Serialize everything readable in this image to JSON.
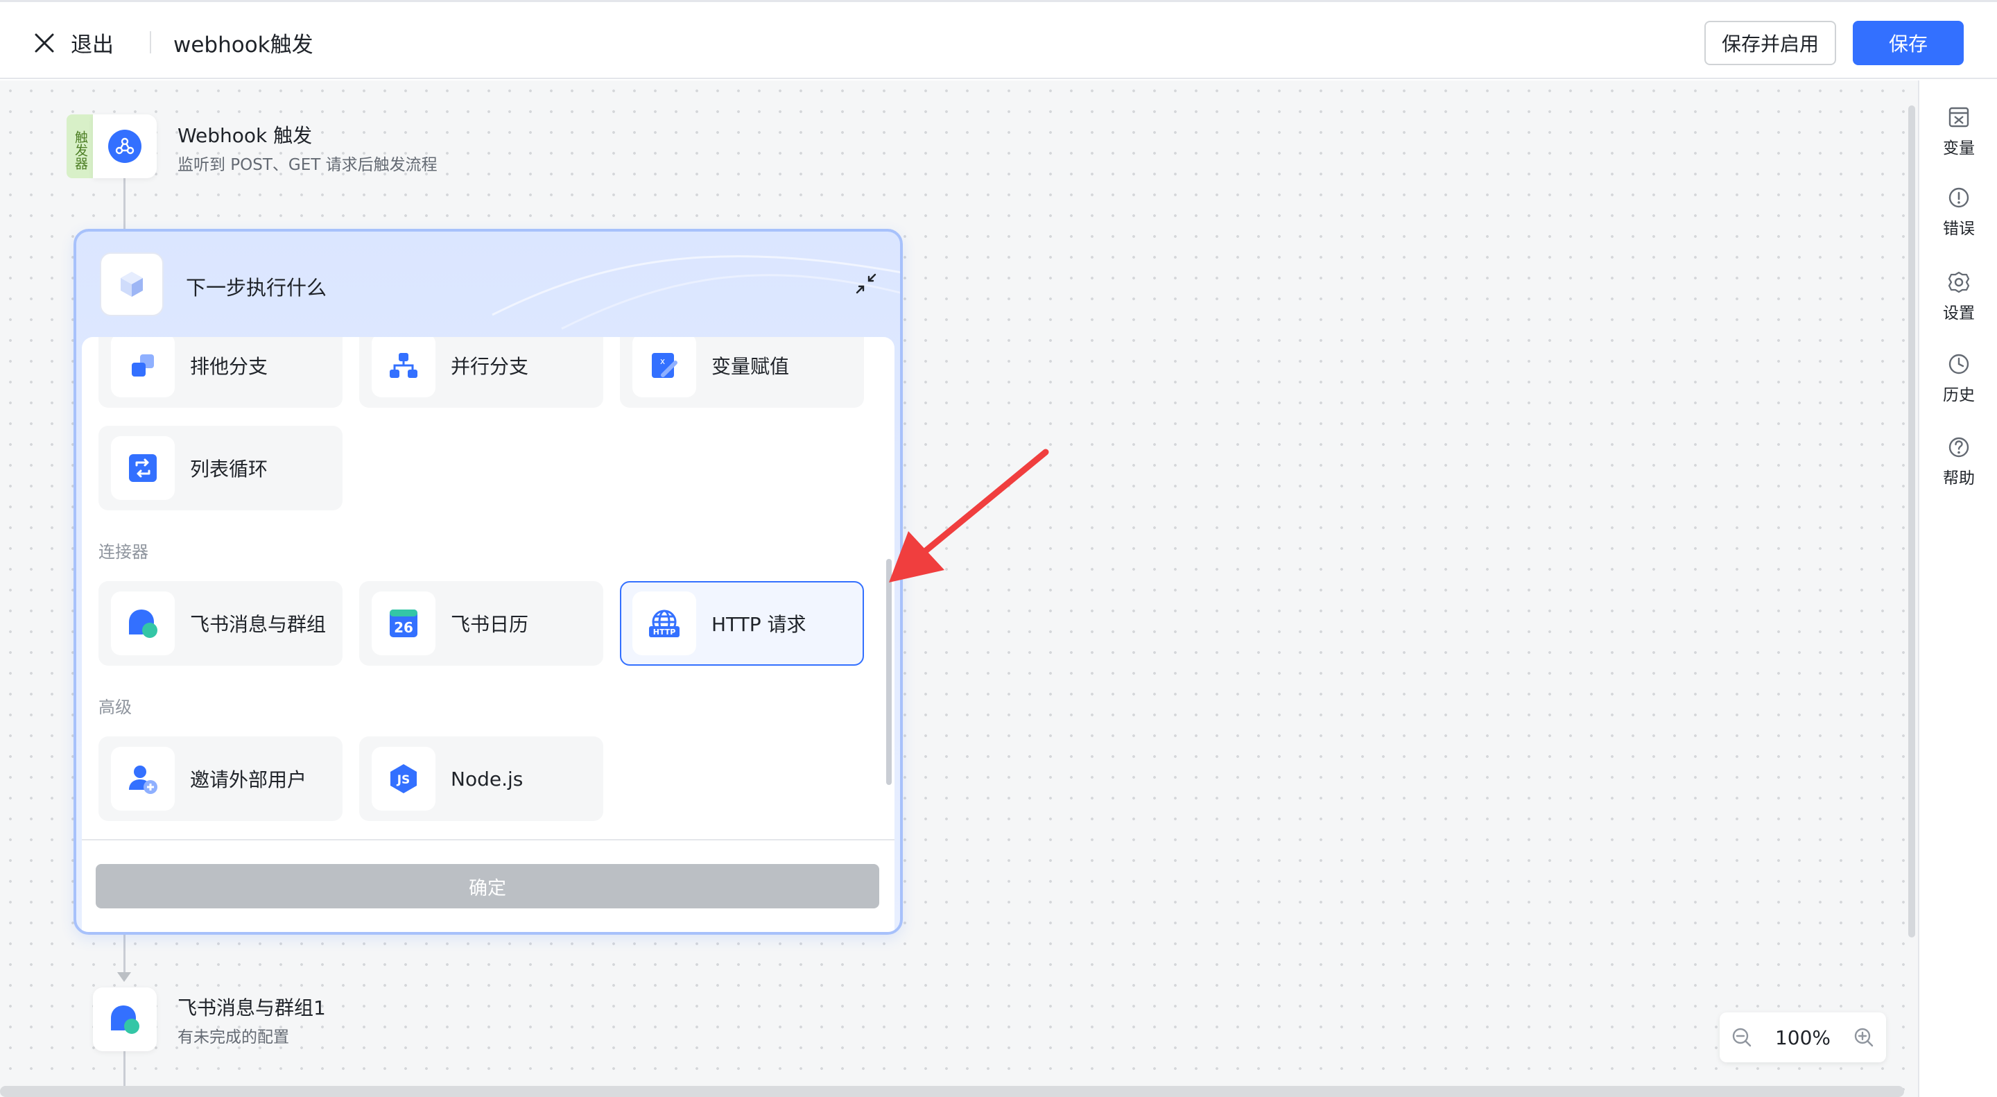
{
  "header": {
    "exit_label": "退出",
    "title": "webhook触发",
    "save_enable_label": "保存并启用",
    "save_label": "保存"
  },
  "trigger": {
    "tag": "触发器",
    "title": "Webhook 触发",
    "subtitle": "监听到 POST、GET 请求后触发流程",
    "icon": "webhook-icon"
  },
  "panel": {
    "title": "下一步执行什么",
    "top_row": [
      {
        "label": "排他分支",
        "icon": "exclusive-branch-icon"
      },
      {
        "label": "并行分支",
        "icon": "parallel-branch-icon"
      },
      {
        "label": "变量赋值",
        "icon": "variable-assign-icon"
      }
    ],
    "loop": {
      "label": "列表循环",
      "icon": "list-loop-icon"
    },
    "connectors_label": "连接器",
    "connectors": [
      {
        "label": "飞书消息与群组",
        "icon": "chat-bubble-icon"
      },
      {
        "label": "飞书日历",
        "icon": "calendar-icon",
        "calendar_day": "26"
      },
      {
        "label": "HTTP 请求",
        "icon": "http-globe-icon",
        "badge": "HTTP",
        "selected": true
      }
    ],
    "advanced_label": "高级",
    "advanced": [
      {
        "label": "邀请外部用户",
        "icon": "invite-user-icon"
      },
      {
        "label": "Node.js",
        "icon": "nodejs-icon",
        "badge": "JS"
      }
    ],
    "confirm_label": "确定"
  },
  "next_node": {
    "title": "飞书消息与群组1",
    "subtitle": "有未完成的配置",
    "icon": "chat-bubble-icon"
  },
  "rail": [
    {
      "label": "变量",
      "icon": "variable-icon"
    },
    {
      "label": "错误",
      "icon": "error-icon"
    },
    {
      "label": "设置",
      "icon": "gear-icon"
    },
    {
      "label": "历史",
      "icon": "clock-icon"
    },
    {
      "label": "帮助",
      "icon": "help-icon"
    }
  ],
  "zoom": {
    "level": "100%"
  },
  "colors": {
    "accent": "#3370ff",
    "annotation_arrow": "#f03e3e",
    "trigger_tag_bg": "#d8f0c8"
  }
}
